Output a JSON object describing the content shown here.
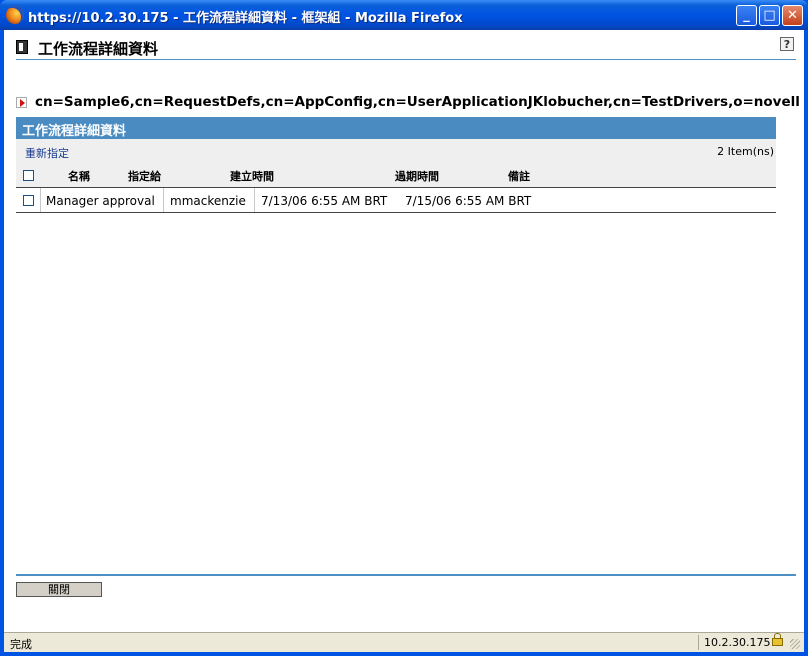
{
  "window": {
    "title": "https://10.2.30.175 - 工作流程詳細資料 - 框架組 - Mozilla Firefox",
    "minimize_label": "_",
    "maximize_label": "□",
    "close_label": "✕"
  },
  "page": {
    "title": "工作流程詳細資料",
    "help_label": "?",
    "dn": "cn=Sample6,cn=RequestDefs,cn=AppConfig,cn=UserApplicationJKlobucher,cn=TestDrivers,o=novell"
  },
  "panel": {
    "title": "工作流程詳細資料",
    "reassign_link": "重新指定",
    "item_count": "2 Item(ns)",
    "columns": [
      "名稱",
      "指定給",
      "建立時間",
      "過期時間",
      "備註"
    ],
    "rows": [
      {
        "name": "Manager approval",
        "assigned_to": "mmackenzie",
        "created": "7/13/06 6:55 AM BRT",
        "expires": "7/15/06 6:55 AM BRT",
        "notes": ""
      }
    ]
  },
  "footer": {
    "close_button": "關閉"
  },
  "statusbar": {
    "status": "完成",
    "host": "10.2.30.175"
  },
  "icons": [
    "firefox-icon",
    "page-icon",
    "help-icon",
    "dn-arrow-icon",
    "lock-icon"
  ]
}
